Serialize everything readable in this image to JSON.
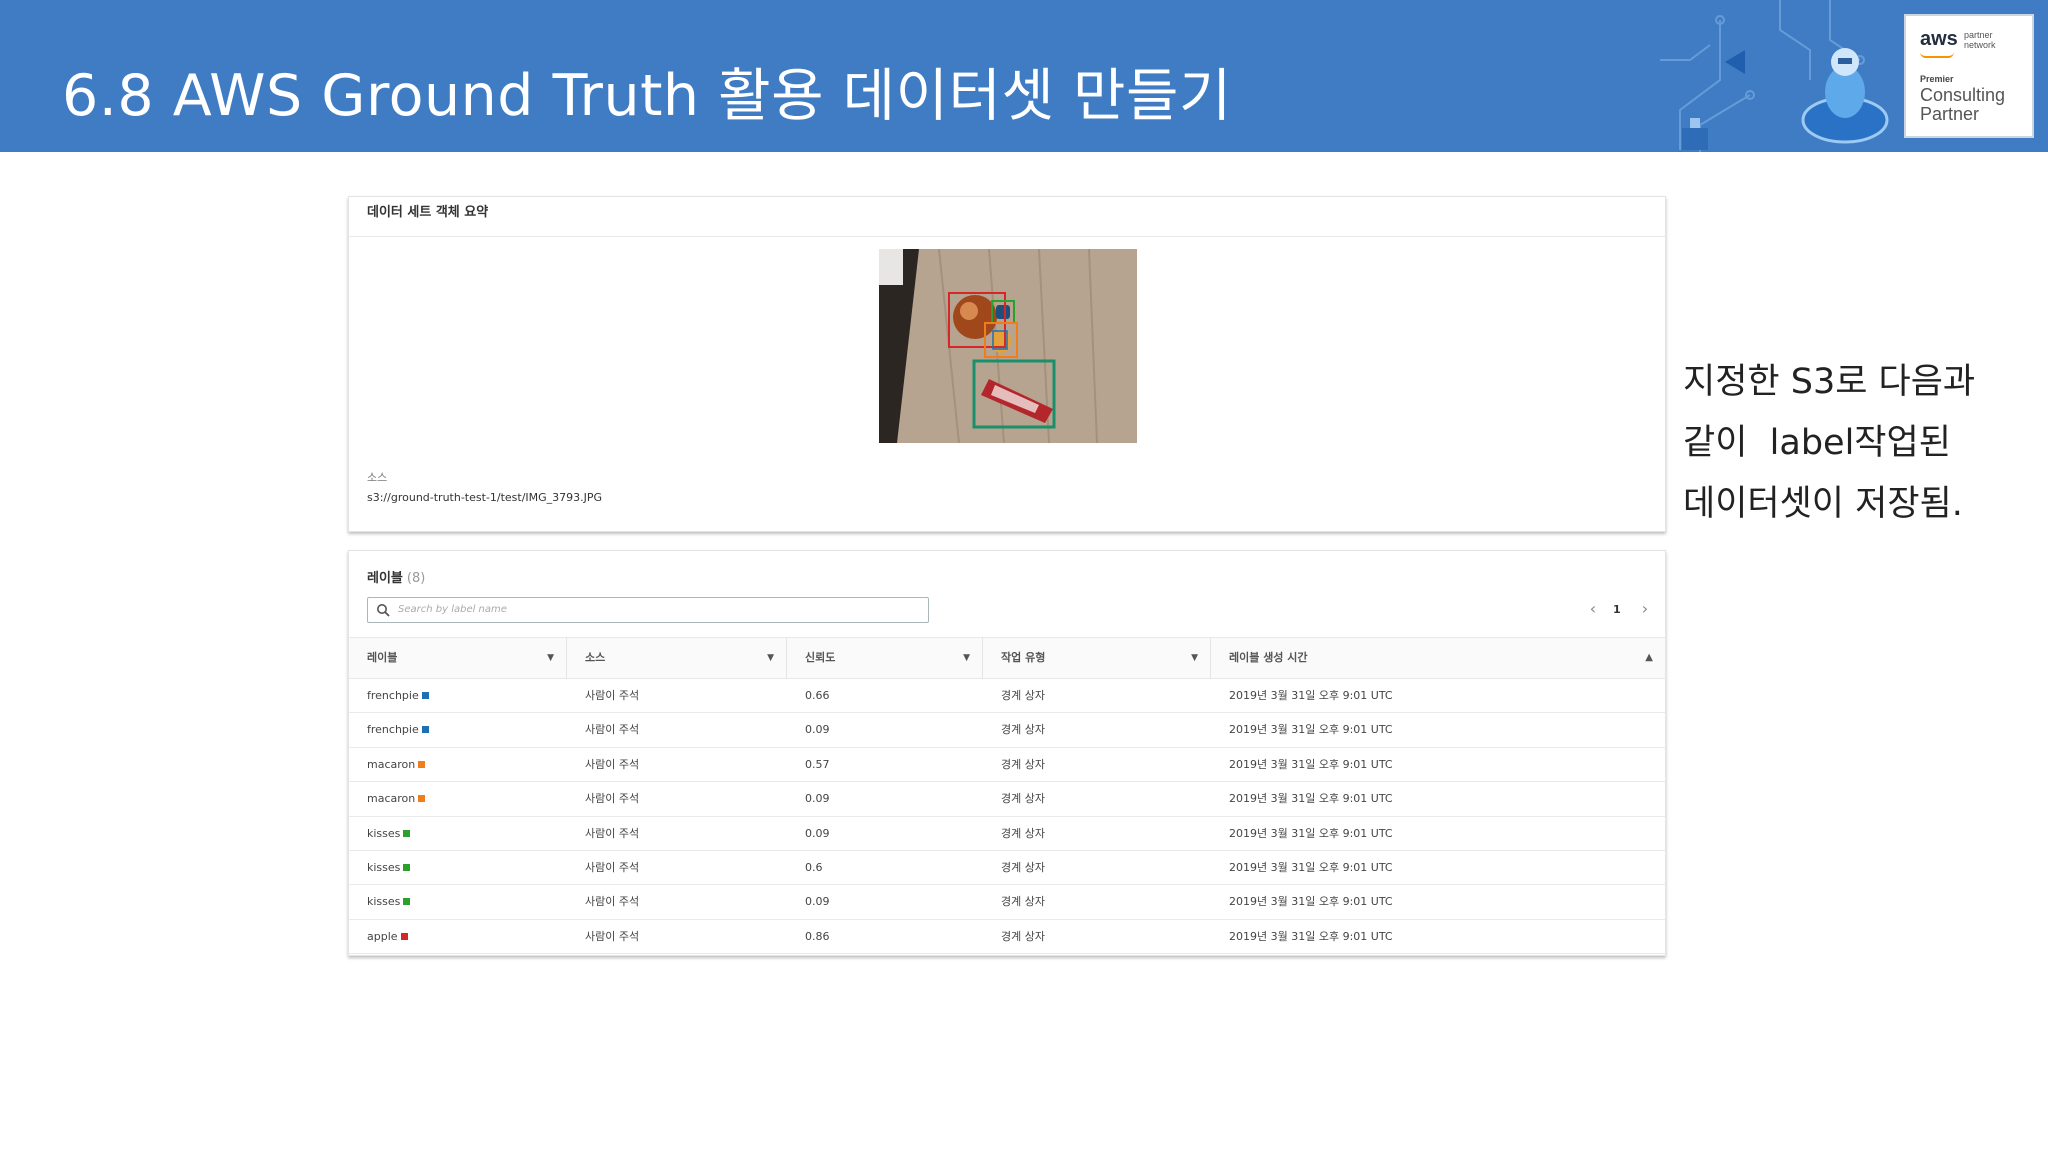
{
  "slide": {
    "title": "6.8 AWS Ground Truth 활용 데이터셋 만들기",
    "brand_color": "#3f7cc4",
    "caption_lines": [
      "지정한 S3로 다음과",
      "같이  label작업된",
      "데이터셋이 저장됨."
    ]
  },
  "badge": {
    "aws": "aws",
    "partner_network": "partner network",
    "premier": "Premier",
    "consulting": "Consulting",
    "partner": "Partner"
  },
  "summary": {
    "title": "데이터 세트 객체 요약",
    "source_label": "소스",
    "source_path": "s3://ground-truth-test-1/test/IMG_3793.JPG"
  },
  "labels_panel": {
    "title": "레이블",
    "count": "(8)",
    "search_placeholder": "Search by label name",
    "page": "1",
    "columns": [
      "레이블",
      "소스",
      "신뢰도",
      "작업 유형",
      "레이블 생성 시간"
    ],
    "rows": [
      {
        "label": "frenchpie",
        "color": "#1f6fb5",
        "source": "사람이 주석",
        "confidence": "0.66",
        "type": "경계 상자",
        "time": "2019년 3월 31일 오후 9:01 UTC"
      },
      {
        "label": "frenchpie",
        "color": "#1f6fb5",
        "source": "사람이 주석",
        "confidence": "0.09",
        "type": "경계 상자",
        "time": "2019년 3월 31일 오후 9:01 UTC"
      },
      {
        "label": "macaron",
        "color": "#f07d1a",
        "source": "사람이 주석",
        "confidence": "0.57",
        "type": "경계 상자",
        "time": "2019년 3월 31일 오후 9:01 UTC"
      },
      {
        "label": "macaron",
        "color": "#f07d1a",
        "source": "사람이 주석",
        "confidence": "0.09",
        "type": "경계 상자",
        "time": "2019년 3월 31일 오후 9:01 UTC"
      },
      {
        "label": "kisses",
        "color": "#2ca02c",
        "source": "사람이 주석",
        "confidence": "0.09",
        "type": "경계 상자",
        "time": "2019년 3월 31일 오후 9:01 UTC"
      },
      {
        "label": "kisses",
        "color": "#2ca02c",
        "source": "사람이 주석",
        "confidence": "0.6",
        "type": "경계 상자",
        "time": "2019년 3월 31일 오후 9:01 UTC"
      },
      {
        "label": "kisses",
        "color": "#2ca02c",
        "source": "사람이 주석",
        "confidence": "0.09",
        "type": "경계 상자",
        "time": "2019년 3월 31일 오후 9:01 UTC"
      },
      {
        "label": "apple",
        "color": "#d62728",
        "source": "사람이 주석",
        "confidence": "0.86",
        "type": "경계 상자",
        "time": "2019년 3월 31일 오후 9:01 UTC"
      }
    ]
  }
}
